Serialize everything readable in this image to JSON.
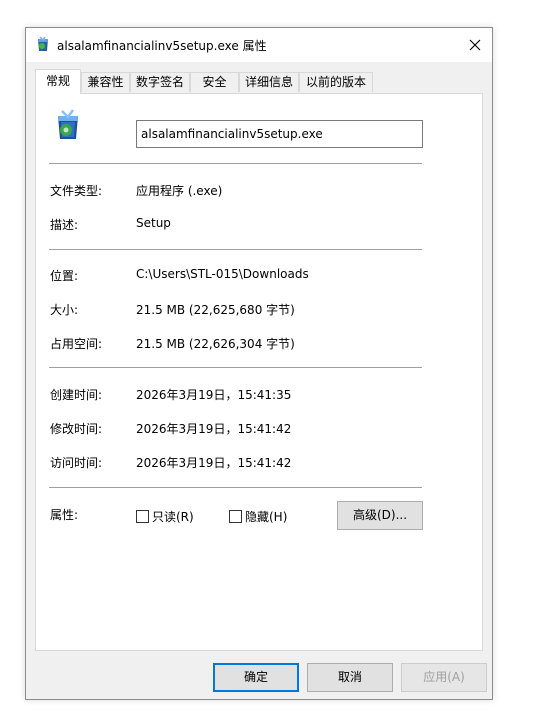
{
  "window": {
    "title": "alsalamfinancialinv5setup.exe 属性"
  },
  "tabs": [
    {
      "label": "常规",
      "active": true
    },
    {
      "label": "兼容性"
    },
    {
      "label": "数字签名"
    },
    {
      "label": "安全"
    },
    {
      "label": "详细信息"
    },
    {
      "label": "以前的版本"
    }
  ],
  "general": {
    "filename": "alsalamfinancialinv5setup.exe",
    "file_type_label": "文件类型:",
    "file_type_value": "应用程序 (.exe)",
    "description_label": "描述:",
    "description_value": "Setup",
    "location_label": "位置:",
    "location_value": "C:\\Users\\STL-015\\Downloads",
    "size_label": "大小:",
    "size_value": "21.5 MB (22,625,680 字节)",
    "size_on_disk_label": "占用空间:",
    "size_on_disk_value": "21.5 MB (22,626,304 字节)",
    "created_label": "创建时间:",
    "created_value": "2026年3月19日，15:41:35",
    "modified_label": "修改时间:",
    "modified_value": "2026年3月19日，15:41:42",
    "accessed_label": "访问时间:",
    "accessed_value": "2026年3月19日，15:41:42",
    "attributes_label": "属性:",
    "readonly_label": "只读(R)",
    "readonly_checked": false,
    "hidden_label": "隐藏(H)",
    "hidden_checked": false,
    "advanced_button": "高级(D)..."
  },
  "footer": {
    "ok": "确定",
    "cancel": "取消",
    "apply": "应用(A)"
  },
  "colors": {
    "accent": "#0078d7",
    "dialog_bg": "#f0f0f0",
    "panel_bg": "#ffffff"
  }
}
